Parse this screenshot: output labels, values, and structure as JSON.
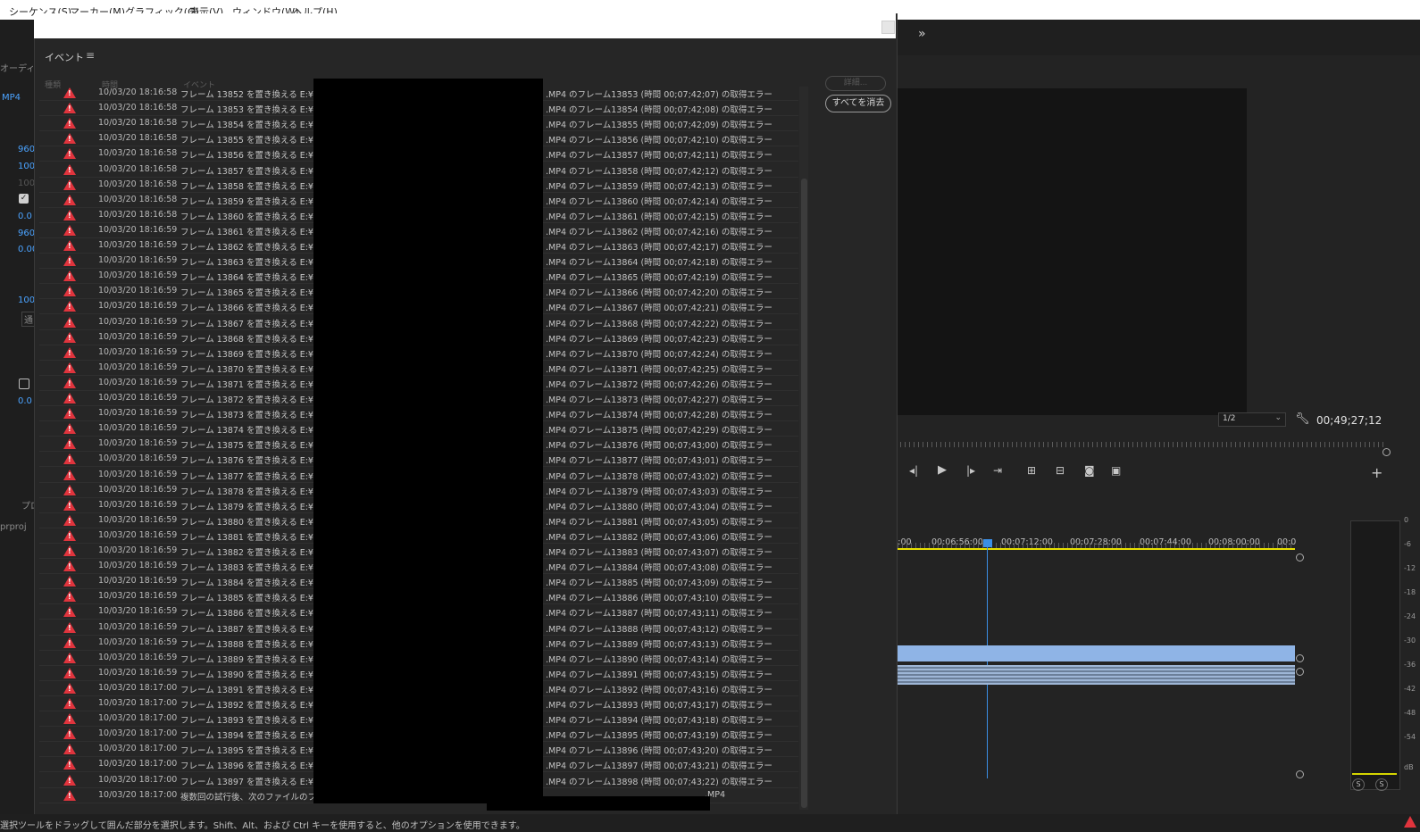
{
  "menubar": {
    "items": [
      "シーケンス(S)",
      "マーカー(M)",
      "グラフィック(G)",
      "表示(V)",
      "ウィンドウ(W)",
      "ヘルプ(H)"
    ]
  },
  "left_panel": {
    "audio_tab": "オーディ",
    "clip_label": "MP4",
    "values": [
      "960",
      "100",
      "100",
      "0.0",
      "960",
      "0.00",
      "100",
      "0.0"
    ],
    "blend_label": "通",
    "project_label": "プロ",
    "project_file": "prproj"
  },
  "event_panel": {
    "title": "イベント",
    "menu_icon": "hamburger-icon",
    "columns": {
      "type": "種類",
      "time": "時間",
      "event": "イベント"
    },
    "details_label": "詳細...",
    "clear_label": "すべてを消去",
    "rows": [
      {
        "ts": "10/03/20 18:16:58",
        "msg": "フレーム 13852 を置き換える E:¥",
        "tail": ".MP4 のフレーム13853 (時間 00;07;42;07) の取得エラー"
      },
      {
        "ts": "10/03/20 18:16:58",
        "msg": "フレーム 13853 を置き換える E:¥",
        "tail": ".MP4 のフレーム13854 (時間 00;07;42;08) の取得エラー"
      },
      {
        "ts": "10/03/20 18:16:58",
        "msg": "フレーム 13854 を置き換える E:¥",
        "tail": ".MP4 のフレーム13855 (時間 00;07;42;09) の取得エラー"
      },
      {
        "ts": "10/03/20 18:16:58",
        "msg": "フレーム 13855 を置き換える E:¥",
        "tail": ".MP4 のフレーム13856 (時間 00;07;42;10) の取得エラー"
      },
      {
        "ts": "10/03/20 18:16:58",
        "msg": "フレーム 13856 を置き換える E:¥",
        "tail": ".MP4 のフレーム13857 (時間 00;07;42;11) の取得エラー"
      },
      {
        "ts": "10/03/20 18:16:58",
        "msg": "フレーム 13857 を置き換える E:¥",
        "tail": ".MP4 のフレーム13858 (時間 00;07;42;12) の取得エラー"
      },
      {
        "ts": "10/03/20 18:16:58",
        "msg": "フレーム 13858 を置き換える E:¥",
        "tail": ".MP4 のフレーム13859 (時間 00;07;42;13) の取得エラー"
      },
      {
        "ts": "10/03/20 18:16:58",
        "msg": "フレーム 13859 を置き換える E:¥",
        "tail": ".MP4 のフレーム13860 (時間 00;07;42;14) の取得エラー"
      },
      {
        "ts": "10/03/20 18:16:58",
        "msg": "フレーム 13860 を置き換える E:¥",
        "tail": ".MP4 のフレーム13861 (時間 00;07;42;15) の取得エラー"
      },
      {
        "ts": "10/03/20 18:16:59",
        "msg": "フレーム 13861 を置き換える E:¥",
        "tail": ".MP4 のフレーム13862 (時間 00;07;42;16) の取得エラー"
      },
      {
        "ts": "10/03/20 18:16:59",
        "msg": "フレーム 13862 を置き換える E:¥",
        "tail": ".MP4 のフレーム13863 (時間 00;07;42;17) の取得エラー"
      },
      {
        "ts": "10/03/20 18:16:59",
        "msg": "フレーム 13863 を置き換える E:¥",
        "tail": ".MP4 のフレーム13864 (時間 00;07;42;18) の取得エラー"
      },
      {
        "ts": "10/03/20 18:16:59",
        "msg": "フレーム 13864 を置き換える E:¥",
        "tail": ".MP4 のフレーム13865 (時間 00;07;42;19) の取得エラー"
      },
      {
        "ts": "10/03/20 18:16:59",
        "msg": "フレーム 13865 を置き換える E:¥",
        "tail": ".MP4 のフレーム13866 (時間 00;07;42;20) の取得エラー"
      },
      {
        "ts": "10/03/20 18:16:59",
        "msg": "フレーム 13866 を置き換える E:¥",
        "tail": ".MP4 のフレーム13867 (時間 00;07;42;21) の取得エラー"
      },
      {
        "ts": "10/03/20 18:16:59",
        "msg": "フレーム 13867 を置き換える E:¥",
        "tail": ".MP4 のフレーム13868 (時間 00;07;42;22) の取得エラー"
      },
      {
        "ts": "10/03/20 18:16:59",
        "msg": "フレーム 13868 を置き換える E:¥",
        "tail": ".MP4 のフレーム13869 (時間 00;07;42;23) の取得エラー"
      },
      {
        "ts": "10/03/20 18:16:59",
        "msg": "フレーム 13869 を置き換える E:¥",
        "tail": ".MP4 のフレーム13870 (時間 00;07;42;24) の取得エラー"
      },
      {
        "ts": "10/03/20 18:16:59",
        "msg": "フレーム 13870 を置き換える E:¥",
        "tail": ".MP4 のフレーム13871 (時間 00;07;42;25) の取得エラー"
      },
      {
        "ts": "10/03/20 18:16:59",
        "msg": "フレーム 13871 を置き換える E:¥",
        "tail": ".MP4 のフレーム13872 (時間 00;07;42;26) の取得エラー"
      },
      {
        "ts": "10/03/20 18:16:59",
        "msg": "フレーム 13872 を置き換える E:¥",
        "tail": ".MP4 のフレーム13873 (時間 00;07;42;27) の取得エラー"
      },
      {
        "ts": "10/03/20 18:16:59",
        "msg": "フレーム 13873 を置き換える E:¥",
        "tail": ".MP4 のフレーム13874 (時間 00;07;42;28) の取得エラー"
      },
      {
        "ts": "10/03/20 18:16:59",
        "msg": "フレーム 13874 を置き換える E:¥",
        "tail": ".MP4 のフレーム13875 (時間 00;07;42;29) の取得エラー"
      },
      {
        "ts": "10/03/20 18:16:59",
        "msg": "フレーム 13875 を置き換える E:¥",
        "tail": ".MP4 のフレーム13876 (時間 00;07;43;00) の取得エラー"
      },
      {
        "ts": "10/03/20 18:16:59",
        "msg": "フレーム 13876 を置き換える E:¥",
        "tail": ".MP4 のフレーム13877 (時間 00;07;43;01) の取得エラー"
      },
      {
        "ts": "10/03/20 18:16:59",
        "msg": "フレーム 13877 を置き換える E:¥",
        "tail": ".MP4 のフレーム13878 (時間 00;07;43;02) の取得エラー"
      },
      {
        "ts": "10/03/20 18:16:59",
        "msg": "フレーム 13878 を置き換える E:¥",
        "tail": ".MP4 のフレーム13879 (時間 00;07;43;03) の取得エラー"
      },
      {
        "ts": "10/03/20 18:16:59",
        "msg": "フレーム 13879 を置き換える E:¥",
        "tail": ".MP4 のフレーム13880 (時間 00;07;43;04) の取得エラー"
      },
      {
        "ts": "10/03/20 18:16:59",
        "msg": "フレーム 13880 を置き換える E:¥",
        "tail": ".MP4 のフレーム13881 (時間 00;07;43;05) の取得エラー"
      },
      {
        "ts": "10/03/20 18:16:59",
        "msg": "フレーム 13881 を置き換える E:¥",
        "tail": ".MP4 のフレーム13882 (時間 00;07;43;06) の取得エラー"
      },
      {
        "ts": "10/03/20 18:16:59",
        "msg": "フレーム 13882 を置き換える E:¥",
        "tail": ".MP4 のフレーム13883 (時間 00;07;43;07) の取得エラー"
      },
      {
        "ts": "10/03/20 18:16:59",
        "msg": "フレーム 13883 を置き換える E:¥",
        "tail": ".MP4 のフレーム13884 (時間 00;07;43;08) の取得エラー"
      },
      {
        "ts": "10/03/20 18:16:59",
        "msg": "フレーム 13884 を置き換える E:¥",
        "tail": ".MP4 のフレーム13885 (時間 00;07;43;09) の取得エラー"
      },
      {
        "ts": "10/03/20 18:16:59",
        "msg": "フレーム 13885 を置き換える E:¥",
        "tail": ".MP4 のフレーム13886 (時間 00;07;43;10) の取得エラー"
      },
      {
        "ts": "10/03/20 18:16:59",
        "msg": "フレーム 13886 を置き換える E:¥",
        "tail": ".MP4 のフレーム13887 (時間 00;07;43;11) の取得エラー"
      },
      {
        "ts": "10/03/20 18:16:59",
        "msg": "フレーム 13887 を置き換える E:¥",
        "tail": ".MP4 のフレーム13888 (時間 00;07;43;12) の取得エラー"
      },
      {
        "ts": "10/03/20 18:16:59",
        "msg": "フレーム 13888 を置き換える E:¥",
        "tail": ".MP4 のフレーム13889 (時間 00;07;43;13) の取得エラー"
      },
      {
        "ts": "10/03/20 18:16:59",
        "msg": "フレーム 13889 を置き換える E:¥",
        "tail": ".MP4 のフレーム13890 (時間 00;07;43;14) の取得エラー"
      },
      {
        "ts": "10/03/20 18:16:59",
        "msg": "フレーム 13890 を置き換える E:¥",
        "tail": ".MP4 のフレーム13891 (時間 00;07;43;15) の取得エラー"
      },
      {
        "ts": "10/03/20 18:17:00",
        "msg": "フレーム 13891 を置き換える E:¥",
        "tail": ".MP4 のフレーム13892 (時間 00;07;43;16) の取得エラー"
      },
      {
        "ts": "10/03/20 18:17:00",
        "msg": "フレーム 13892 を置き換える E:¥",
        "tail": ".MP4 のフレーム13893 (時間 00;07;43;17) の取得エラー"
      },
      {
        "ts": "10/03/20 18:17:00",
        "msg": "フレーム 13893 を置き換える E:¥",
        "tail": ".MP4 のフレーム13894 (時間 00;07;43;18) の取得エラー"
      },
      {
        "ts": "10/03/20 18:17:00",
        "msg": "フレーム 13894 を置き換える E:¥",
        "tail": ".MP4 のフレーム13895 (時間 00;07;43;19) の取得エラー"
      },
      {
        "ts": "10/03/20 18:17:00",
        "msg": "フレーム 13895 を置き換える E:¥",
        "tail": ".MP4 のフレーム13896 (時間 00;07;43;20) の取得エラー"
      },
      {
        "ts": "10/03/20 18:17:00",
        "msg": "フレーム 13896 を置き換える E:¥",
        "tail": ".MP4 のフレーム13897 (時間 00;07;43;21) の取得エラー"
      },
      {
        "ts": "10/03/20 18:17:00",
        "msg": "フレーム 13897 を置き換える E:¥",
        "tail": ".MP4 のフレーム13898 (時間 00;07;43;22) の取得エラー"
      }
    ],
    "last_row": {
      "ts": "10/03/20 18:17:00",
      "msg": "複数回の試行後、次のファイルのフレーム置換の試行の繰り返しを中止します：E:¥",
      "tail": ".MP4"
    }
  },
  "program_monitor": {
    "expand_icon": "double-chevron-right-icon",
    "resolution": "1/2",
    "timecode": "00;49;27;12"
  },
  "timeline": {
    "timecodes": [
      ":40:00",
      "00:06:56:00",
      "00:07:12:00",
      "00:07:28:00",
      "00:07:44:00",
      "00:08:00:00",
      "00:0"
    ]
  },
  "audio_meter": {
    "scale": [
      "0",
      "-6",
      "-12",
      "-18",
      "-24",
      "-30",
      "-36",
      "-42",
      "-48",
      "-54",
      "dB"
    ],
    "solo_labels": [
      "S",
      "S"
    ]
  },
  "status_bar": {
    "text": "選択ツールをドラッグして囲んだ部分を選択します。Shift、Alt、および Ctrl キーを使用すると、他のオプションを使用できます。"
  },
  "colors": {
    "accent": "#4ba3ff",
    "warning": "#e0343d",
    "clip_blue": "#8fb4e6",
    "playhead": "#3b8fe6",
    "work_area": "#e8e000"
  }
}
